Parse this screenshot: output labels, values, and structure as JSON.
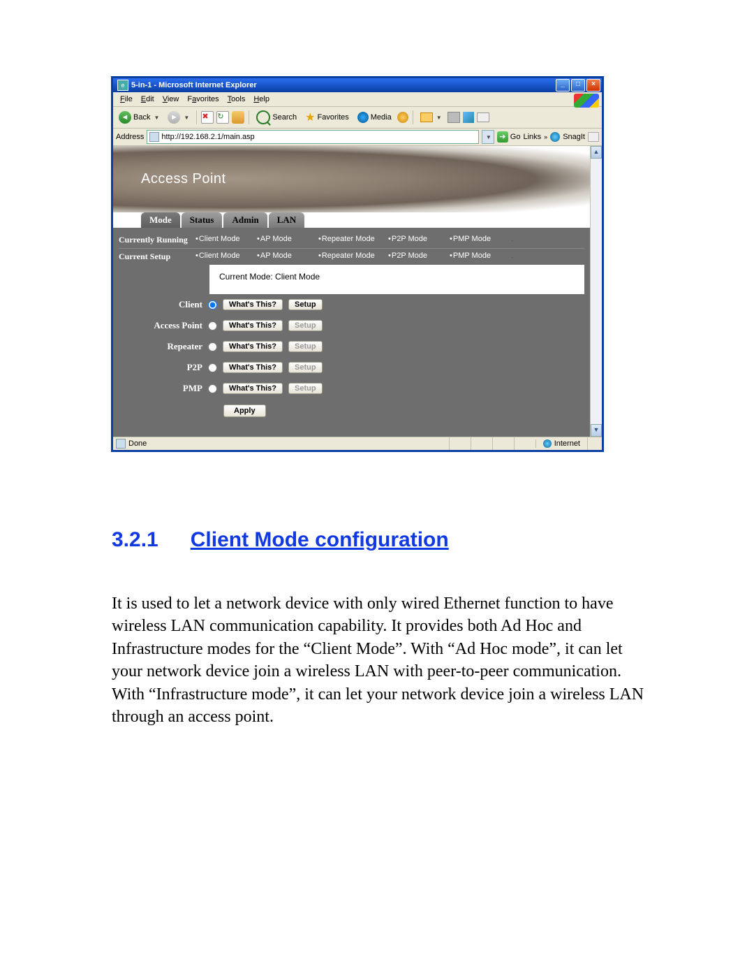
{
  "browser": {
    "window_title": "5-in-1 - Microsoft Internet Explorer",
    "menus": [
      "File",
      "Edit",
      "View",
      "Favorites",
      "Tools",
      "Help"
    ],
    "toolbar": {
      "back": "Back",
      "search": "Search",
      "favorites": "Favorites",
      "media": "Media"
    },
    "address_label": "Address",
    "url": "http://192.168.2.1/main.asp",
    "go": "Go",
    "links": "Links",
    "snagit": "SnagIt",
    "status_left": "Done",
    "status_zone": "Internet"
  },
  "page": {
    "banner_title": "Access Point",
    "tabs": [
      "Mode",
      "Status",
      "Admin",
      "LAN"
    ],
    "active_tab": 0,
    "rows": [
      {
        "label": "Currently Running",
        "cols": [
          "Client Mode",
          "AP Mode",
          "Repeater Mode",
          "P2P Mode",
          "PMP Mode"
        ],
        "dot": "."
      },
      {
        "label": "Current Setup",
        "cols": [
          "Client Mode",
          "AP Mode",
          "Repeater Mode",
          "P2P Mode",
          "PMP Mode"
        ],
        "dot": "."
      }
    ],
    "current_mode_line": "Current Mode: Client Mode",
    "modes": [
      {
        "name": "Client",
        "selected": true,
        "setup_enabled": true
      },
      {
        "name": "Access Point",
        "selected": false,
        "setup_enabled": false
      },
      {
        "name": "Repeater",
        "selected": false,
        "setup_enabled": false
      },
      {
        "name": "P2P",
        "selected": false,
        "setup_enabled": false
      },
      {
        "name": "PMP",
        "selected": false,
        "setup_enabled": false
      }
    ],
    "whats_this": "What's This?",
    "setup": "Setup",
    "apply": "Apply"
  },
  "doc": {
    "heading_num": "3.2.1",
    "heading_text": "Client Mode configuration",
    "paragraph": "It is used to let a network device with only wired Ethernet function to have wireless LAN communication capability. It provides both Ad Hoc and Infrastructure modes for the “Client Mode”. With “Ad Hoc mode”, it can let your network device join a wireless LAN with peer-to-peer communication. With “Infrastructure mode”, it can let your network device join a wireless LAN through an access point."
  }
}
